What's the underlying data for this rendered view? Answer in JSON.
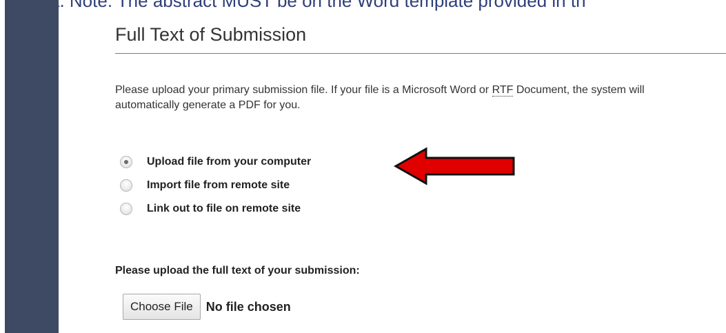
{
  "top_fragment": "a.  Note: The abstract MUST be on the Word template provided in th",
  "heading": "Full Text of Submission",
  "description": {
    "part1": "Please upload your primary submission file. If your file is a Microsoft Word or ",
    "abbr": "RTF",
    "part2": " Document, the system will automatically generate a PDF for you."
  },
  "options": [
    {
      "label": "Upload file from your computer",
      "checked": true
    },
    {
      "label": "Import file from remote site",
      "checked": false
    },
    {
      "label": "Link out to file on remote site",
      "checked": false
    }
  ],
  "upload_prompt": "Please upload the full text of your submission:",
  "file_input": {
    "button_label": "Choose File",
    "status": "No file chosen"
  },
  "colors": {
    "sidebar": "#3e4a64",
    "arrow_fill": "#e00000",
    "arrow_stroke": "#111111"
  }
}
